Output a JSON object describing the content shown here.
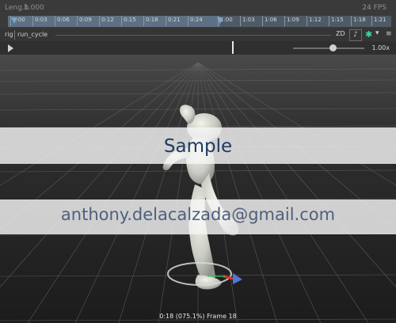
{
  "timeline": {
    "length_label": "Leng.h",
    "length_value": "1.000",
    "fps_label": "24 FPS",
    "ticks": [
      "0:00",
      "0:03",
      "0:06",
      "0:09",
      "0:12",
      "0:15",
      "0:18",
      "0:21",
      "0:24",
      "1:00",
      "1:03",
      "1:06",
      "1:09",
      "1:12",
      "1:15",
      "1:18",
      "1:21"
    ]
  },
  "rig_row": {
    "rig_label": "rig",
    "clip_name": "run_cycle",
    "zd_label": "ZD",
    "note_icon": "note-icon",
    "onion_icon": "onion-skin-icon",
    "menu_icon": "menu-icon"
  },
  "playback": {
    "speed_value": "1.00x",
    "speed_fraction": 0.55
  },
  "watermark": {
    "title": "Sample",
    "email": "anthony.delacalzada@gmail.com"
  },
  "status": {
    "frame_text": "0:18 (075.1%) Frame 18"
  },
  "colors": {
    "accent_onion": "#3fd3a3",
    "watermark_title": "#1f3a63",
    "watermark_email": "#4f5f7e"
  }
}
